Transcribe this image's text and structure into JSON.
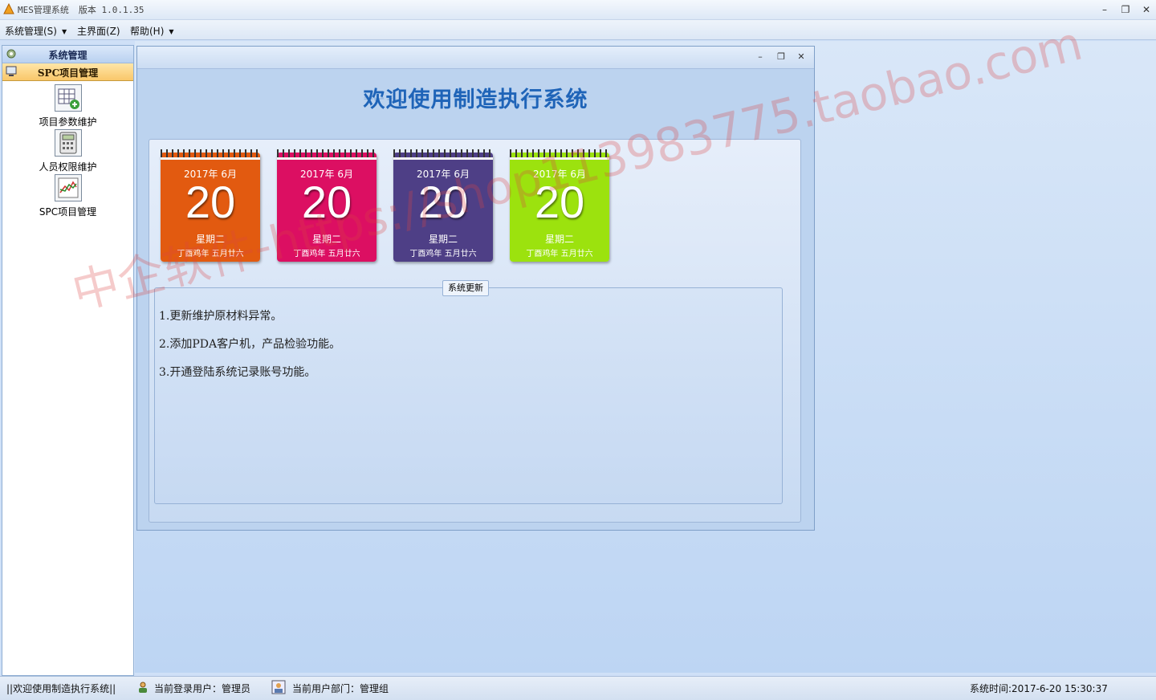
{
  "window": {
    "title": "MES管理系统",
    "version": "版本 1.0.1.35",
    "controls": [
      "minimize-icon",
      "restore-icon",
      "close-icon"
    ]
  },
  "menu": {
    "items": [
      {
        "label": "系统管理(S)"
      },
      {
        "label": "主界面(Z)"
      },
      {
        "label": "帮助(H)"
      }
    ]
  },
  "sidebar": {
    "section1": "系统管理",
    "section2": "SPC项目管理",
    "items": [
      {
        "label": "项目参数维护",
        "icon": "table-add-icon"
      },
      {
        "label": "人员权限维护",
        "icon": "calculator-icon"
      },
      {
        "label": "SPC项目管理",
        "icon": "chart-icon"
      }
    ]
  },
  "welcome": {
    "title": "欢迎使用制造执行系统"
  },
  "calendars": [
    {
      "ym": "2017年 6月",
      "day": "20",
      "weekday": "星期二",
      "lunar": "丁酉鸡年 五月廿六",
      "color": "#e25a10"
    },
    {
      "ym": "2017年 6月",
      "day": "20",
      "weekday": "星期二",
      "lunar": "丁酉鸡年 五月廿六",
      "color": "#dc0f62"
    },
    {
      "ym": "2017年 6月",
      "day": "20",
      "weekday": "星期二",
      "lunar": "丁酉鸡年 五月廿六",
      "color": "#4e3f86"
    },
    {
      "ym": "2017年 6月",
      "day": "20",
      "weekday": "星期二",
      "lunar": "丁酉鸡年 五月廿六",
      "color": "#9ce20e"
    }
  ],
  "updates": {
    "title": "系统更新",
    "lines": [
      "1.更新维护原材料异常。",
      "2.添加PDA客户机，产品检验功能。",
      "3.开通登陆系统记录账号功能。"
    ]
  },
  "status": {
    "welcome": "||欢迎使用制造执行系统||",
    "user": "当前登录用户：管理员",
    "dept": "当前用户部门：管理组",
    "time": "系统时间:2017-6-20 15:30:37"
  },
  "watermark": "中企软件-https://shop113983775.taobao.com"
}
